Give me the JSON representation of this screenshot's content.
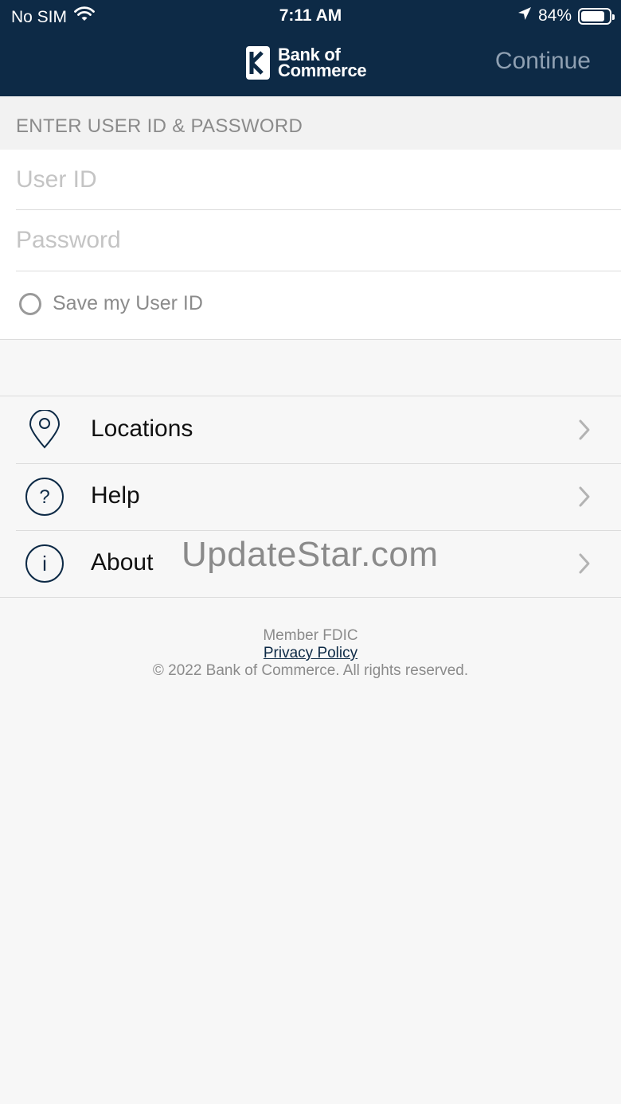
{
  "status_bar": {
    "carrier": "No SIM",
    "time": "7:11 AM",
    "battery": "84%",
    "battery_level": 0.84
  },
  "header": {
    "logo_line1": "Bank of",
    "logo_line2": "Commerce",
    "continue_label": "Continue"
  },
  "login": {
    "section_title": "ENTER USER ID & PASSWORD",
    "user_id_placeholder": "User ID",
    "password_placeholder": "Password",
    "save_user_id_label": "Save my User ID"
  },
  "menu": {
    "items": [
      {
        "label": "Locations"
      },
      {
        "label": "Help"
      },
      {
        "label": "About"
      }
    ]
  },
  "watermark": "UpdateStar.com",
  "footer": {
    "member": "Member FDIC",
    "privacy": "Privacy Policy",
    "copyright": "© 2022 Bank of Commerce. All rights reserved."
  }
}
